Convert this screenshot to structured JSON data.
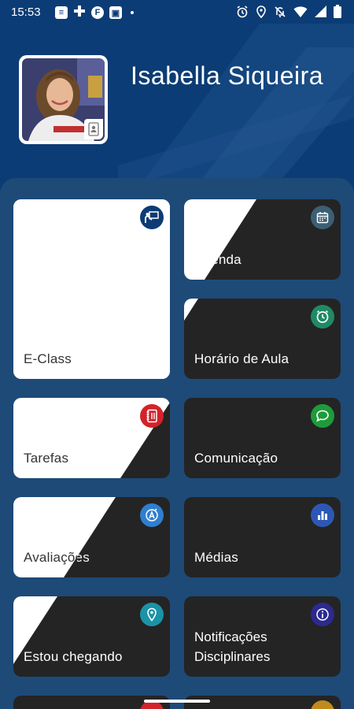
{
  "status_bar": {
    "time": "15:53",
    "left_icons": [
      "news-icon",
      "medical-cross-icon",
      "flipboard-icon",
      "app-icon"
    ],
    "right_icons": [
      "alarm-icon",
      "location-icon",
      "notifications-off-icon",
      "wifi-icon",
      "signal-icon",
      "battery-icon"
    ]
  },
  "profile": {
    "name": "Isabella Siqueira",
    "avatar_icon": "student-photo",
    "badge_icon": "id-card-icon"
  },
  "colors": {
    "background": "#0c3c75",
    "panel": "#1e4a78",
    "card_dark": "#242424",
    "card_light": "#ffffff",
    "eclass_icon": "#0d3b74",
    "agenda_icon": "#3b5f73",
    "horario_icon": "#1f8a64",
    "tarefas_icon": "#d2232a",
    "comunicacao_icon": "#1e9b3a",
    "avaliacoes_icon": "#2f7fd0",
    "medias_icon": "#2c58b4",
    "estou_icon": "#1a93a8",
    "notificacoes_icon": "#2c2a8f"
  },
  "menu": {
    "eclass": {
      "label": "E-Class",
      "icon": "presentation-icon"
    },
    "agenda": {
      "label": "Agenda",
      "icon": "calendar-icon"
    },
    "horario": {
      "label": "Horário de Aula",
      "icon": "clock-icon"
    },
    "tarefas": {
      "label": "Tarefas",
      "icon": "homework-icon"
    },
    "comunicacao": {
      "label": "Comunicação",
      "icon": "chat-icon"
    },
    "avaliacoes": {
      "label": "Avaliações",
      "icon": "grade-a-icon"
    },
    "medias": {
      "label": "Médias",
      "icon": "bar-chart-icon"
    },
    "estou_chegando": {
      "label": "Estou chegando",
      "icon": "location-pin-icon"
    },
    "notificacoes": {
      "label": "Notificações Disciplinares",
      "line1": "Notificações",
      "line2": "Disciplinares",
      "icon": "info-icon"
    }
  }
}
